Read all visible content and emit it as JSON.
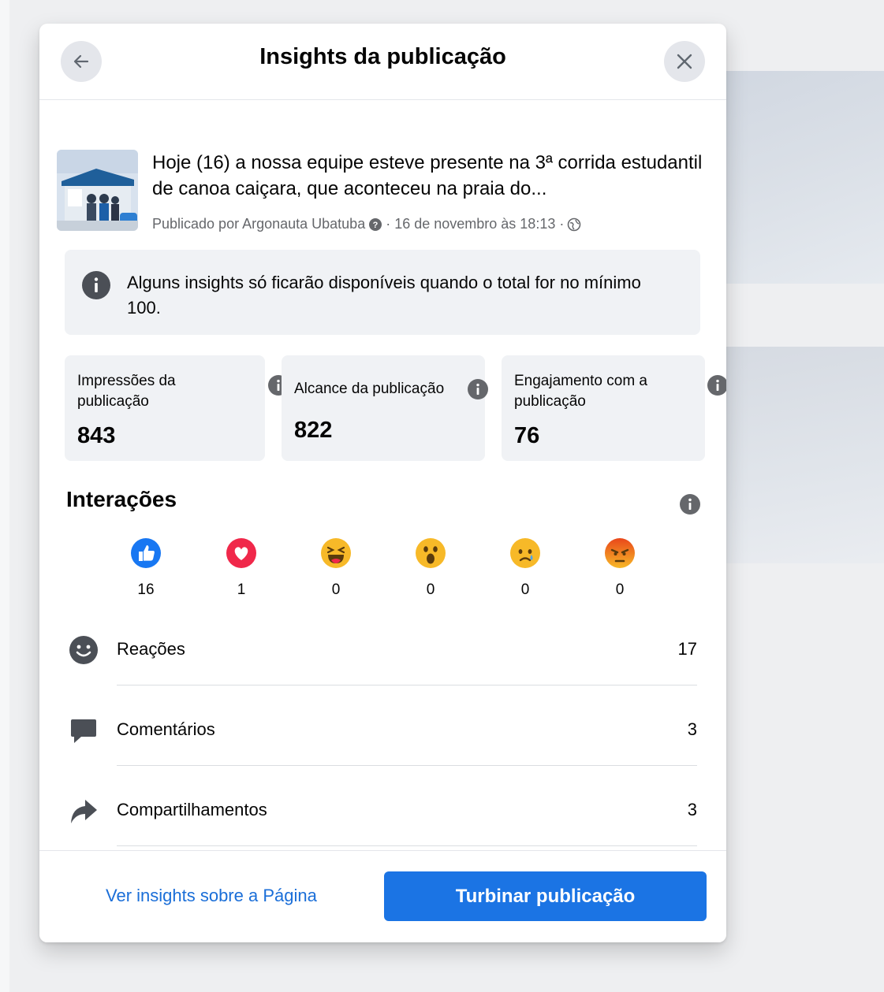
{
  "dialog": {
    "title": "Insights da publicação"
  },
  "post": {
    "text": "Hoje (16) a nossa equipe esteve presente na 3ª corrida estudantil de canoa caiçara, que aconteceu na praia do...",
    "meta_prefix": "Publicado por Argonauta Ubatuba",
    "meta_date": "· 16 de novembro às 18:13 ·"
  },
  "notice": {
    "text": "Alguns insights só ficarão disponíveis quando o total for no mínimo 100."
  },
  "stats": {
    "impressions_label": "Impressões da publicação",
    "impressions_value": "843",
    "reach_label": "Alcance da publicação",
    "reach_value": "822",
    "engagement_label": "Engajamento com a publicação",
    "engagement_value": "76"
  },
  "interactions": {
    "title": "Interações",
    "reactions": [
      {
        "icon": "like-icon",
        "count": "16"
      },
      {
        "icon": "love-icon",
        "count": "1"
      },
      {
        "icon": "haha-icon",
        "count": "0"
      },
      {
        "icon": "wow-icon",
        "count": "0"
      },
      {
        "icon": "sad-icon",
        "count": "0"
      },
      {
        "icon": "angry-icon",
        "count": "0"
      }
    ],
    "rows": [
      {
        "icon": "smiley-icon",
        "label": "Reações",
        "value": "17"
      },
      {
        "icon": "comment-icon",
        "label": "Comentários",
        "value": "3"
      },
      {
        "icon": "share-icon",
        "label": "Compartilhamentos",
        "value": "3"
      }
    ]
  },
  "footer": {
    "page_insights_link": "Ver insights sobre a Página",
    "boost_button": "Turbinar publicação"
  },
  "colors": {
    "accent": "#1b74e4",
    "link": "#1a6ed8",
    "panel": "#f0f2f5"
  }
}
